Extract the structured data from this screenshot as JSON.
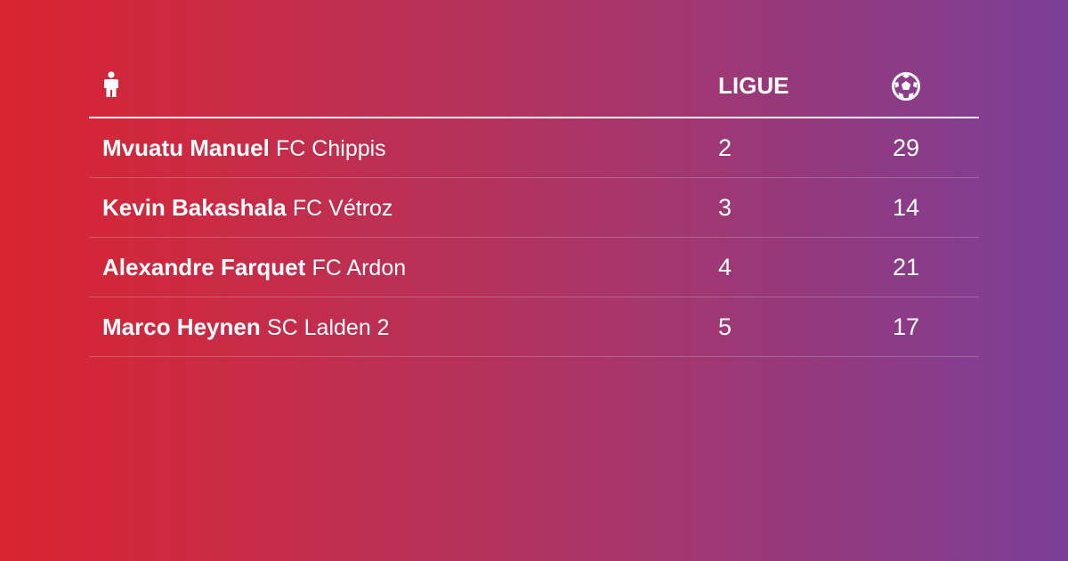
{
  "header": {
    "player_icon": "person-icon",
    "league_label": "LIGUE",
    "goals_icon": "soccer-ball-icon"
  },
  "rows": [
    {
      "player": "Mvuatu Manuel",
      "club": "FC Chippis",
      "league": "2",
      "goals": "29"
    },
    {
      "player": "Kevin Bakashala",
      "club": "FC Vétroz",
      "league": "3",
      "goals": "14"
    },
    {
      "player": "Alexandre Farquet",
      "club": "FC Ardon",
      "league": "4",
      "goals": "21"
    },
    {
      "player": "Marco Heynen",
      "club": "SC Lalden 2",
      "league": "5",
      "goals": "17"
    }
  ],
  "colors": {
    "gradient_start": "#da2430",
    "gradient_end": "#7b3f98",
    "text": "#ffffff"
  }
}
